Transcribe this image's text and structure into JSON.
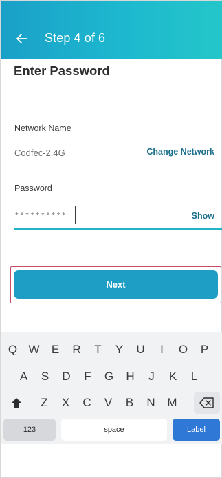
{
  "header": {
    "title": "Step 4 of 6"
  },
  "page": {
    "heading": "Enter Password"
  },
  "network": {
    "label": "Network Name",
    "value": "Codfec-2.4G",
    "change_label": "Change Network"
  },
  "password": {
    "label": "Password",
    "masked_value": "**********",
    "show_label": "Show"
  },
  "next_button": {
    "label": "Next"
  },
  "keyboard": {
    "row1": [
      "Q",
      "W",
      "E",
      "R",
      "T",
      "Y",
      "U",
      "I",
      "O",
      "P"
    ],
    "row2": [
      "A",
      "S",
      "D",
      "F",
      "G",
      "H",
      "J",
      "K",
      "L"
    ],
    "row3": [
      "Z",
      "X",
      "C",
      "V",
      "B",
      "N",
      "M"
    ],
    "numbers_label": "123",
    "space_label": "space",
    "action_label": "Label"
  },
  "colors": {
    "header_gradient_start": "#1aa0c8",
    "header_gradient_end": "#24c6c9",
    "link": "#1b6f8c",
    "button": "#1e9ec5",
    "highlight_border": "#c94c6c",
    "keyboard_action": "#2f78d6"
  },
  "icons": {
    "back": "arrow-left-icon",
    "shift": "shift-arrow-icon",
    "delete": "backspace-icon"
  }
}
